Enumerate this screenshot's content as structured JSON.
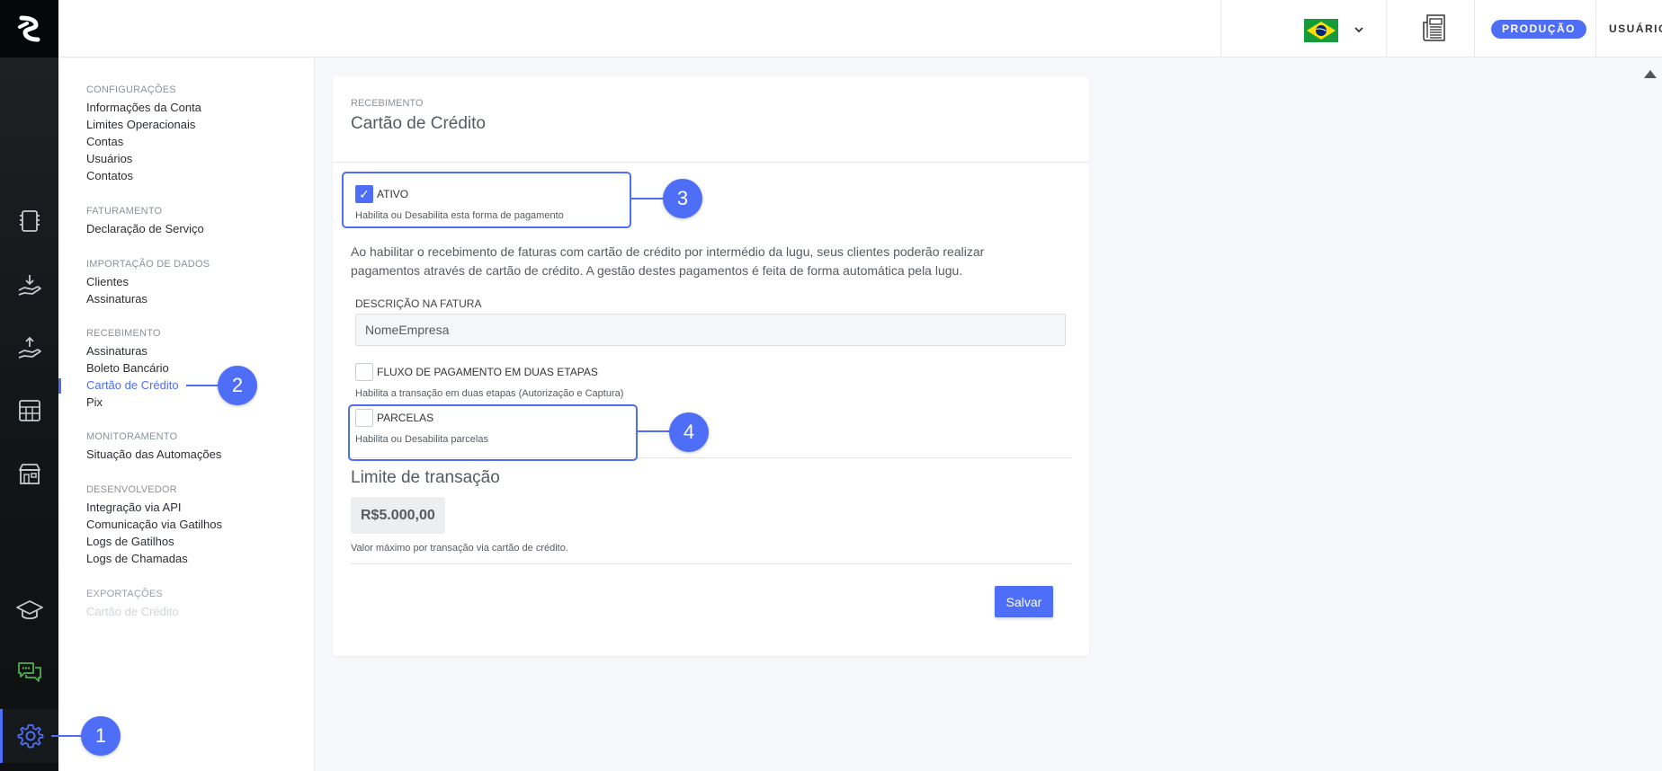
{
  "header": {
    "environment_badge": "PRODUÇÃO",
    "user_label": "USUÁRIO",
    "language_flag": "brazil-flag-icon",
    "news_icon": "newspaper-icon"
  },
  "rail": {
    "items": [
      {
        "name": "logo-icon"
      },
      {
        "name": "invoice-icon"
      },
      {
        "name": "hand-receive-icon"
      },
      {
        "name": "hand-send-icon"
      },
      {
        "name": "calculator-icon"
      },
      {
        "name": "store-icon"
      },
      {
        "name": "academy-cap-icon"
      },
      {
        "name": "chat-icon"
      },
      {
        "name": "gear-icon"
      }
    ]
  },
  "nav": {
    "sections": {
      "configuracoes": "CONFIGURAÇÕES",
      "faturamento": "FATURAMENTO",
      "importacao": "IMPORTAÇÃO DE DADOS",
      "recebimento": "RECEBIMENTO",
      "monitoramento": "MONITORAMENTO",
      "desenvolvedor": "DESENVOLVEDOR",
      "exportacoes": "EXPORTAÇÕES"
    },
    "items": {
      "info_conta": "Informações da Conta",
      "limites": "Limites Operacionais",
      "contas": "Contas",
      "usuarios": "Usuários",
      "contatos": "Contatos",
      "declaracao": "Declaração de Serviço",
      "clientes": "Clientes",
      "assinaturas_import": "Assinaturas",
      "assinaturas_receb": "Assinaturas",
      "boleto": "Boleto Bancário",
      "cartao": "Cartão de Crédito",
      "pix": "Pix",
      "situacao": "Situação das Automações",
      "api": "Integração via API",
      "gatilhos": "Comunicação via Gatilhos",
      "logs_gatilhos": "Logs de Gatilhos",
      "logs_chamadas": "Logs de Chamadas",
      "export_cartao": "Cartão de Crédito"
    }
  },
  "card": {
    "eyebrow": "RECEBIMENTO",
    "title": "Cartão de Crédito",
    "ativo": {
      "label": "ATIVO",
      "help": "Habilita ou Desabilita esta forma de pagamento",
      "checked": true,
      "check_glyph": "✓"
    },
    "description": "Ao habilitar o recebimento de faturas com cartão de crédito por intermédio da lugu, seus clientes poderão realizar pagamentos através de cartão de crédito. A gestão destes pagamentos é feita de forma automática pela lugu.",
    "descricao_fatura": {
      "label": "DESCRIÇÃO NA FATURA",
      "value": "NomeEmpresa"
    },
    "fluxo": {
      "label": "FLUXO DE PAGAMENTO EM DUAS ETAPAS",
      "help": "Habilita a transação em duas etapas (Autorização e Captura)",
      "checked": false
    },
    "parcelas": {
      "label": "PARCELAS",
      "help": "Habilita ou Desabilita parcelas",
      "checked": false
    },
    "limite": {
      "title": "Limite de transação",
      "value": "R$5.000,00",
      "help": "Valor máximo por transação via cartão de crédito."
    },
    "save_label": "Salvar"
  },
  "annotations": {
    "c1": "1",
    "c2": "2",
    "c3": "3",
    "c4": "4"
  },
  "colors": {
    "accent": "#4f6ef7",
    "rail_bg": "#121416",
    "chat_icon": "#4caf50"
  }
}
